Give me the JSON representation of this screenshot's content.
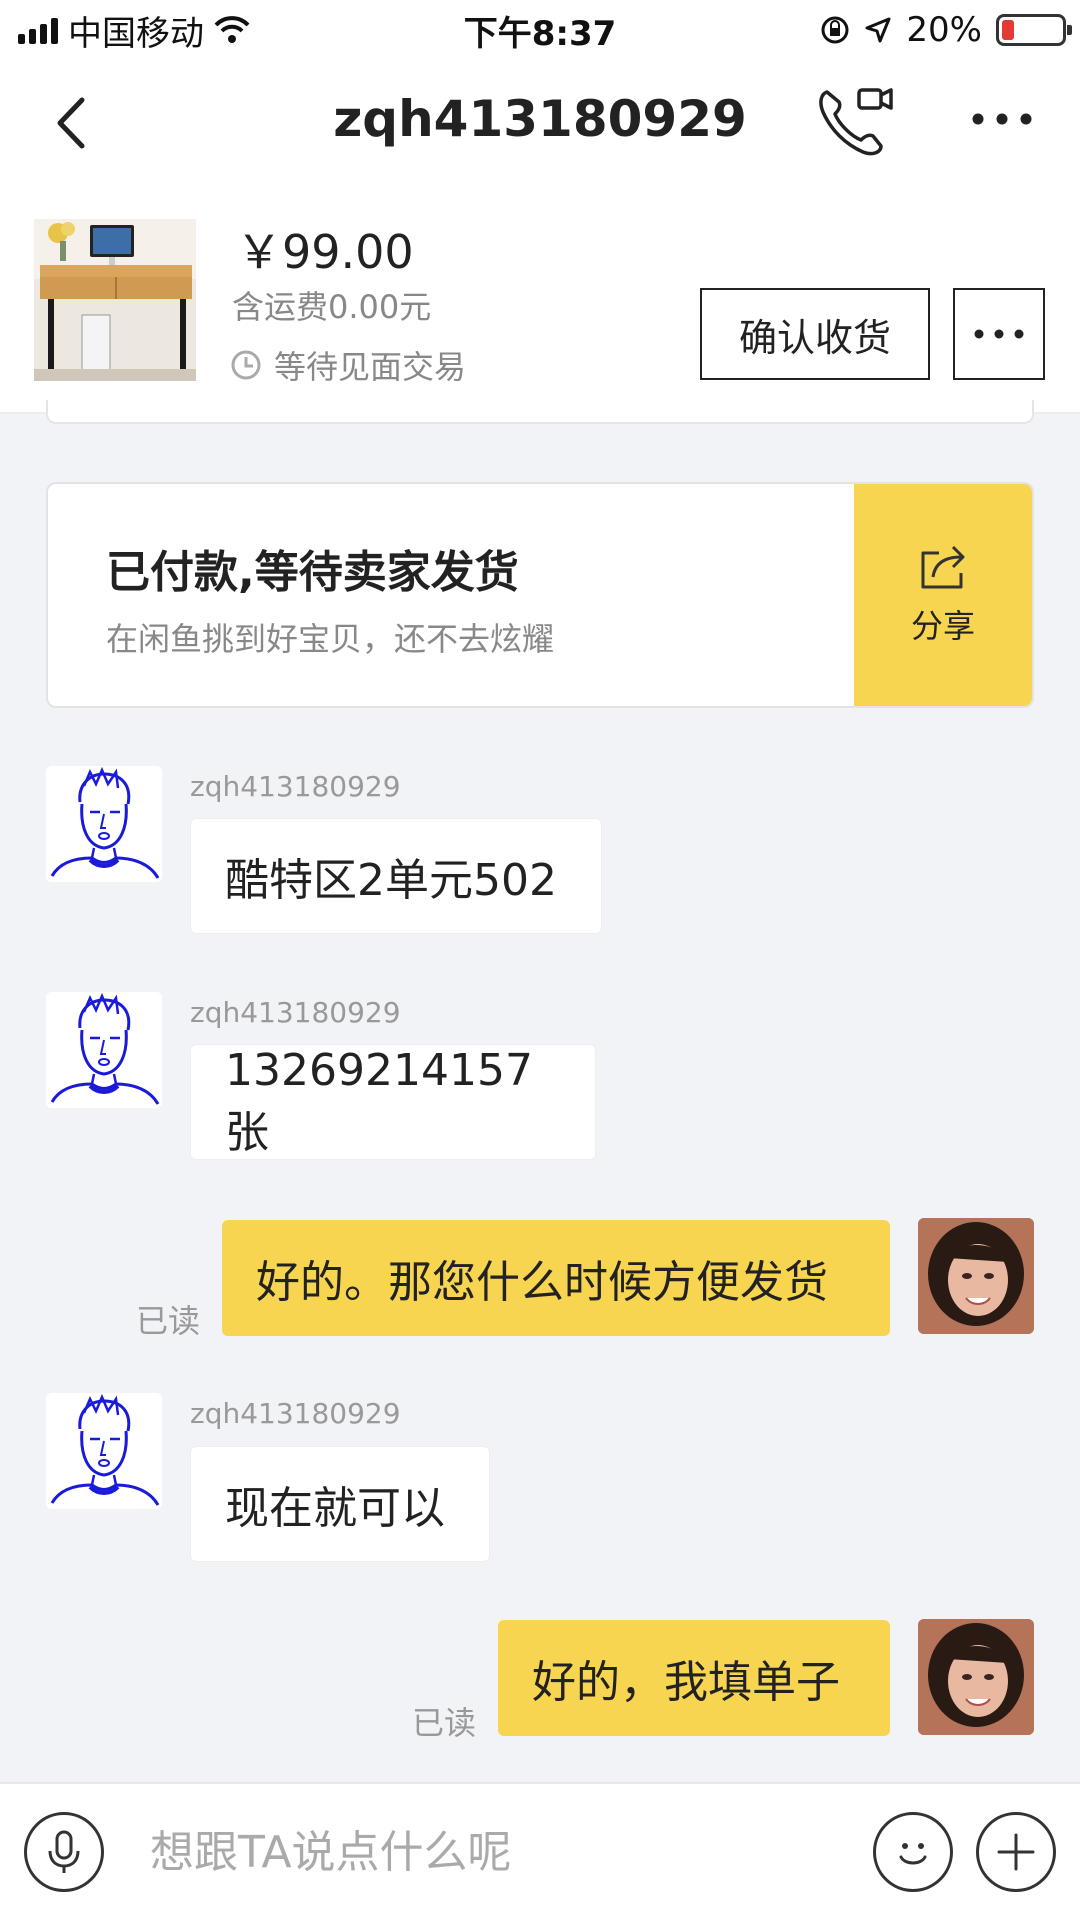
{
  "status_bar": {
    "carrier": "中国移动",
    "time": "下午8:37",
    "battery": "20%",
    "battery_level": 0.2,
    "battery_color": "#e53935"
  },
  "nav": {
    "title": "zqh413180929",
    "icons": [
      "back-chevron-icon",
      "video-call-icon",
      "more-dots-icon"
    ]
  },
  "product": {
    "price": "￥99.00",
    "shipping": "含运费0.00元",
    "status": "等待见面交易",
    "confirm_label": "确认收货"
  },
  "order_card": {
    "title": "已付款,等待卖家发货",
    "subtitle": "在闲鱼挑到好宝贝，还不去炫耀",
    "share_label": "分享",
    "accent": "#f8d551"
  },
  "messages": [
    {
      "sender": "zqh413180929",
      "text": "酷特区2单元502",
      "direction": "in"
    },
    {
      "sender": "zqh413180929",
      "text": "13269214157 张",
      "direction": "in"
    },
    {
      "text": "好的。那您什么时候方便发货",
      "direction": "out",
      "read": "已读"
    },
    {
      "sender": "zqh413180929",
      "text": "现在就可以",
      "direction": "in"
    },
    {
      "text": "好的，我填单子",
      "direction": "out",
      "read": "已读"
    }
  ],
  "input": {
    "placeholder": "想跟TA说点什么呢"
  }
}
